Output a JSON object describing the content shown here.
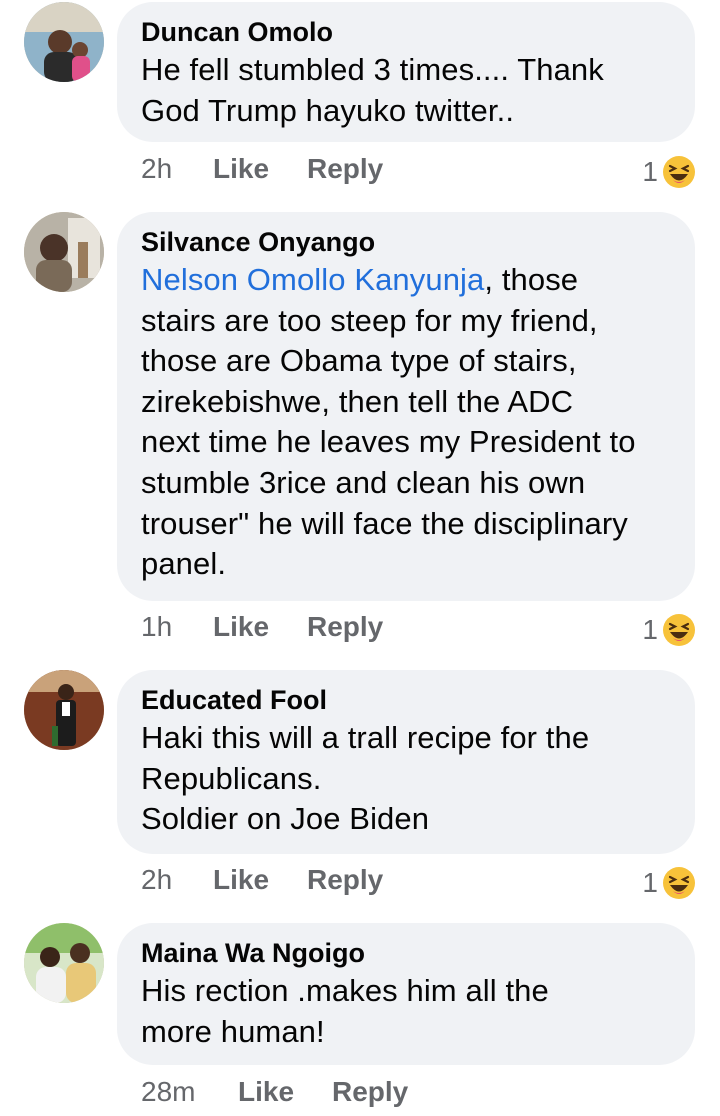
{
  "comments": [
    {
      "author": "Duncan Omolo",
      "text": "He fell stumbled 3 times.... Thank\nGod Trump hayuko twitter..",
      "mention": "",
      "time": "2h",
      "like_label": "Like",
      "reply_label": "Reply",
      "reaction_count": "1",
      "reaction_icon": "haha-emoji-icon"
    },
    {
      "author": "Silvance Onyango",
      "mention": "Nelson Omollo Kanyunja",
      "text": ", those\nstairs are too steep for my friend,\nthose are Obama type of stairs,\nzirekebishwe, then tell the ADC\nnext time he leaves my President to\nstumble 3rice and clean his own\ntrouser\" he will face the disciplinary\npanel.",
      "time": "1h",
      "like_label": "Like",
      "reply_label": "Reply",
      "reaction_count": "1",
      "reaction_icon": "haha-emoji-icon"
    },
    {
      "author": "Educated Fool",
      "mention": "",
      "text": "Haki this will a trall recipe for the\nRepublicans.\nSoldier on Joe Biden",
      "time": "2h",
      "like_label": "Like",
      "reply_label": "Reply",
      "reaction_count": "1",
      "reaction_icon": "haha-emoji-icon"
    },
    {
      "author": "Maina Wa Ngoigo",
      "mention": "",
      "text": "His rection .makes him all the\nmore human!",
      "time": "28m",
      "like_label": "Like",
      "reply_label": "Reply"
    }
  ],
  "colors": {
    "bubble": "#f0f2f5",
    "mention": "#216fdb",
    "secondary_text": "#65676b",
    "haha_yellow": "#f7c23a"
  }
}
